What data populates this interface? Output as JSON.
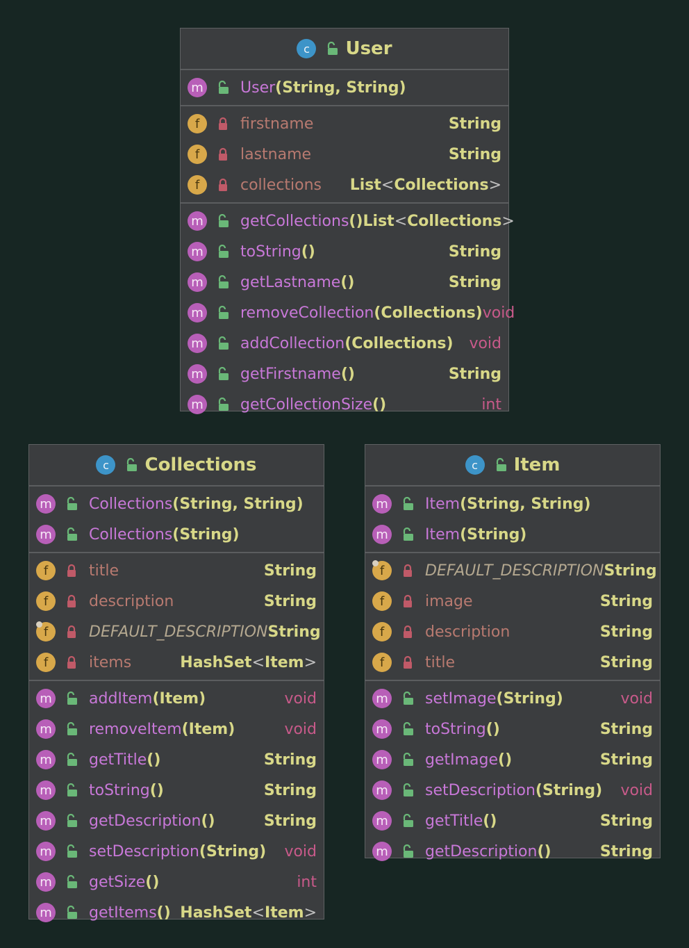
{
  "classes": [
    {
      "id": "user",
      "name": "User",
      "constructors": [
        {
          "name": "User",
          "params": "(String, String)",
          "ret": ""
        }
      ],
      "fields": [
        {
          "name": "firstname",
          "ret": "String",
          "static": false
        },
        {
          "name": "lastname",
          "ret": "String",
          "static": false
        },
        {
          "name": "collections",
          "ret": "List<Collections>",
          "static": false
        }
      ],
      "methods": [
        {
          "name": "getCollections",
          "params": "()",
          "ret": "List<Collections>"
        },
        {
          "name": "toString",
          "params": "()",
          "ret": "String"
        },
        {
          "name": "getLastname",
          "params": "()",
          "ret": "String"
        },
        {
          "name": "removeCollection",
          "params": "(Collections)",
          "ret": "void"
        },
        {
          "name": "addCollection",
          "params": "(Collections)",
          "ret": "void"
        },
        {
          "name": "getFirstname",
          "params": "()",
          "ret": "String"
        },
        {
          "name": "getCollectionSize",
          "params": "()",
          "ret": "int"
        }
      ]
    },
    {
      "id": "collections",
      "name": "Collections",
      "constructors": [
        {
          "name": "Collections",
          "params": "(String, String)",
          "ret": ""
        },
        {
          "name": "Collections",
          "params": "(String)",
          "ret": ""
        }
      ],
      "fields": [
        {
          "name": "title",
          "ret": "String",
          "static": false
        },
        {
          "name": "description",
          "ret": "String",
          "static": false
        },
        {
          "name": "DEFAULT_DESCRIPTION",
          "ret": "String",
          "static": true
        },
        {
          "name": "items",
          "ret": "HashSet<Item>",
          "static": false
        }
      ],
      "methods": [
        {
          "name": "addItem",
          "params": "(Item)",
          "ret": "void"
        },
        {
          "name": "removeItem",
          "params": "(Item)",
          "ret": "void"
        },
        {
          "name": "getTitle",
          "params": "()",
          "ret": "String"
        },
        {
          "name": "toString",
          "params": "()",
          "ret": "String"
        },
        {
          "name": "getDescription",
          "params": "()",
          "ret": "String"
        },
        {
          "name": "setDescription",
          "params": "(String)",
          "ret": "void"
        },
        {
          "name": "getSize",
          "params": "()",
          "ret": "int"
        },
        {
          "name": "getItems",
          "params": "()",
          "ret": "HashSet<Item>"
        }
      ]
    },
    {
      "id": "item",
      "name": "Item",
      "constructors": [
        {
          "name": "Item",
          "params": "(String, String)",
          "ret": ""
        },
        {
          "name": "Item",
          "params": "(String)",
          "ret": ""
        }
      ],
      "fields": [
        {
          "name": "DEFAULT_DESCRIPTION",
          "ret": "String",
          "static": true
        },
        {
          "name": "image",
          "ret": "String",
          "static": false
        },
        {
          "name": "description",
          "ret": "String",
          "static": false
        },
        {
          "name": "title",
          "ret": "String",
          "static": false
        }
      ],
      "methods": [
        {
          "name": "setImage",
          "params": "(String)",
          "ret": "void"
        },
        {
          "name": "toString",
          "params": "()",
          "ret": "String"
        },
        {
          "name": "getImage",
          "params": "()",
          "ret": "String"
        },
        {
          "name": "setDescription",
          "params": "(String)",
          "ret": "void"
        },
        {
          "name": "getTitle",
          "params": "()",
          "ret": "String"
        },
        {
          "name": "getDescription",
          "params": "()",
          "ret": "String"
        }
      ]
    }
  ],
  "colors": {
    "background": "#172623",
    "box": "#3b3d3f",
    "type": "#d8d888",
    "method": "#c878d8",
    "field": "#b87a70",
    "keyword": "#c85a8a",
    "class_badge": "#3d94c8",
    "method_badge": "#b85fb8",
    "field_badge": "#d8a84a"
  },
  "icons": {
    "class_badge": "class-c-icon",
    "method_badge": "method-m-icon",
    "field_badge": "field-f-icon",
    "public": "unlocked-icon",
    "private": "lock-icon",
    "static": "static-pin-icon"
  }
}
